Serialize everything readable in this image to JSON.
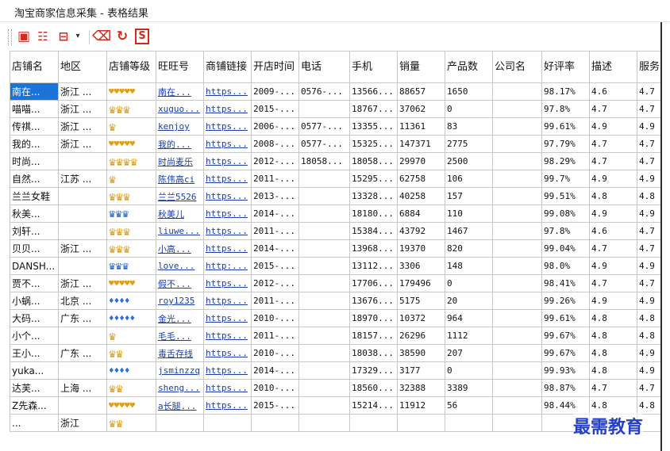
{
  "window": {
    "title": "淘宝商家信息采集 - 表格结果"
  },
  "toolbar": {
    "icons": [
      "excel-export-icon",
      "list-view-icon",
      "table-view-icon",
      "eraser-icon",
      "refresh-icon",
      "sql-export-icon"
    ],
    "colors": {
      "red": "#d42a1e"
    }
  },
  "table": {
    "columns": [
      "店铺名",
      "地区",
      "店铺等级",
      "旺旺号",
      "商铺链接",
      "开店时间",
      "电话",
      "手机",
      "销量",
      "产品数",
      "公司名",
      "好评率",
      "描述",
      "服务"
    ],
    "rows": [
      {
        "shop": "南在...",
        "region": "浙江 ...",
        "rank": "♥♥♥♥♥",
        "rank_kind": "heart",
        "ww": "南在...",
        "link": "https...",
        "open": "2009-...",
        "tel": "0576-...",
        "mobile": "13566...",
        "sales": "88657",
        "products": "1650",
        "company": "",
        "rate": "98.17%",
        "desc": "4.6",
        "serv": "4.7"
      },
      {
        "shop": "喵喵...",
        "region": "浙江 ...",
        "rank": "♛♛♛",
        "rank_kind": "crown",
        "ww": "xuguo...",
        "link": "https...",
        "open": "2015-...",
        "tel": "",
        "mobile": "18767...",
        "sales": "37062",
        "products": "0",
        "company": "",
        "rate": "97.8%",
        "desc": "4.7",
        "serv": "4.7"
      },
      {
        "shop": "传祺...",
        "region": "浙江 ...",
        "rank": "♛",
        "rank_kind": "crown",
        "ww": "kenjoy",
        "link": "https...",
        "open": "2006-...",
        "tel": "0577-...",
        "mobile": "13355...",
        "sales": "11361",
        "products": "83",
        "company": "",
        "rate": "99.61%",
        "desc": "4.9",
        "serv": "4.9"
      },
      {
        "shop": "我的...",
        "region": "浙江 ...",
        "rank": "♥♥♥♥♥",
        "rank_kind": "heart",
        "ww": "我的...",
        "link": "https...",
        "open": "2008-...",
        "tel": "0577-...",
        "mobile": "15325...",
        "sales": "147371",
        "products": "2775",
        "company": "",
        "rate": "97.79%",
        "desc": "4.7",
        "serv": "4.7"
      },
      {
        "shop": "时尚...",
        "region": "",
        "rank": "♛♛♛♛",
        "rank_kind": "crown",
        "ww": "时尚麦乐",
        "link": "https...",
        "open": "2012-...",
        "tel": "18058...",
        "mobile": "18058...",
        "sales": "29970",
        "products": "2500",
        "company": "",
        "rate": "98.29%",
        "desc": "4.7",
        "serv": "4.7"
      },
      {
        "shop": "自然...",
        "region": "江苏 ...",
        "rank": "♛",
        "rank_kind": "crown",
        "ww": "陈伟高ci",
        "link": "https...",
        "open": "2011-...",
        "tel": "",
        "mobile": "15295...",
        "sales": "62758",
        "products": "106",
        "company": "",
        "rate": "99.7%",
        "desc": "4.9",
        "serv": "4.9"
      },
      {
        "shop": "兰兰女鞋",
        "region": "",
        "rank": "♛♛♛",
        "rank_kind": "crown",
        "ww": "兰兰5526",
        "link": "https...",
        "open": "2013-...",
        "tel": "",
        "mobile": "13328...",
        "sales": "40258",
        "products": "157",
        "company": "",
        "rate": "99.51%",
        "desc": "4.8",
        "serv": "4.8"
      },
      {
        "shop": "秋美...",
        "region": "",
        "rank": "♛♛♛",
        "rank_kind": "bcrown",
        "ww": "秋美儿",
        "link": "https...",
        "open": "2014-...",
        "tel": "",
        "mobile": "18180...",
        "sales": "6884",
        "products": "110",
        "company": "",
        "rate": "99.08%",
        "desc": "4.9",
        "serv": "4.9"
      },
      {
        "shop": "刘轩...",
        "region": "",
        "rank": "♛♛♛",
        "rank_kind": "crown",
        "ww": "liuwe...",
        "link": "https...",
        "open": "2011-...",
        "tel": "",
        "mobile": "15384...",
        "sales": "43792",
        "products": "1467",
        "company": "",
        "rate": "97.8%",
        "desc": "4.6",
        "serv": "4.7"
      },
      {
        "shop": "贝贝...",
        "region": "浙江 ...",
        "rank": "♛♛♛",
        "rank_kind": "crown",
        "ww": "小高...",
        "link": "https...",
        "open": "2014-...",
        "tel": "",
        "mobile": "13968...",
        "sales": "19370",
        "products": "820",
        "company": "",
        "rate": "99.04%",
        "desc": "4.7",
        "serv": "4.7"
      },
      {
        "shop": "DANSH...",
        "region": "",
        "rank": "♛♛♛",
        "rank_kind": "bcrown",
        "ww": "love...",
        "link": "http:...",
        "open": "2015-...",
        "tel": "",
        "mobile": "13112...",
        "sales": "3306",
        "products": "148",
        "company": "",
        "rate": "98.0%",
        "desc": "4.9",
        "serv": "4.9"
      },
      {
        "shop": "贾不...",
        "region": "浙江 ...",
        "rank": "♥♥♥♥♥",
        "rank_kind": "heart",
        "ww": "假不...",
        "link": "https...",
        "open": "2012-...",
        "tel": "",
        "mobile": "17706...",
        "sales": "179496",
        "products": "0",
        "company": "",
        "rate": "98.41%",
        "desc": "4.7",
        "serv": "4.7"
      },
      {
        "shop": "小蜗...",
        "region": "北京 ...",
        "rank": "♦♦♦♦",
        "rank_kind": "diamond",
        "ww": "roy1235",
        "link": "https...",
        "open": "2011-...",
        "tel": "",
        "mobile": "13676...",
        "sales": "5175",
        "products": "20",
        "company": "",
        "rate": "99.26%",
        "desc": "4.9",
        "serv": "4.9"
      },
      {
        "shop": "大码...",
        "region": "广东 ...",
        "rank": "♦♦♦♦♦",
        "rank_kind": "diamond",
        "ww": "金光...",
        "link": "https...",
        "open": "2010-...",
        "tel": "",
        "mobile": "18970...",
        "sales": "10372",
        "products": "964",
        "company": "",
        "rate": "99.61%",
        "desc": "4.8",
        "serv": "4.8"
      },
      {
        "shop": "小个...",
        "region": "",
        "rank": "♛",
        "rank_kind": "crown",
        "ww": "毛毛...",
        "link": "https...",
        "open": "2011-...",
        "tel": "",
        "mobile": "18157...",
        "sales": "26296",
        "products": "1112",
        "company": "",
        "rate": "99.67%",
        "desc": "4.8",
        "serv": "4.8"
      },
      {
        "shop": "王小...",
        "region": "广东 ...",
        "rank": "♛♛",
        "rank_kind": "crown",
        "ww": "毒舌存线",
        "link": "https...",
        "open": "2010-...",
        "tel": "",
        "mobile": "18038...",
        "sales": "38590",
        "products": "207",
        "company": "",
        "rate": "99.67%",
        "desc": "4.8",
        "serv": "4.9"
      },
      {
        "shop": "yuka...",
        "region": "",
        "rank": "♦♦♦♦",
        "rank_kind": "diamond",
        "ww": "jsminzzq",
        "link": "https...",
        "open": "2014-...",
        "tel": "",
        "mobile": "17329...",
        "sales": "3177",
        "products": "0",
        "company": "",
        "rate": "99.93%",
        "desc": "4.8",
        "serv": "4.9"
      },
      {
        "shop": "达芙...",
        "region": "上海 ...",
        "rank": "♛♛",
        "rank_kind": "crown",
        "ww": "sheng...",
        "link": "https...",
        "open": "2010-...",
        "tel": "",
        "mobile": "18560...",
        "sales": "32388",
        "products": "3389",
        "company": "",
        "rate": "98.87%",
        "desc": "4.7",
        "serv": "4.7"
      },
      {
        "shop": "Z先森...",
        "region": "",
        "rank": "♥♥♥♥♥",
        "rank_kind": "heart",
        "ww": "a长腿...",
        "link": "https...",
        "open": "2015-...",
        "tel": "",
        "mobile": "15214...",
        "sales": "11912",
        "products": "56",
        "company": "",
        "rate": "98.44%",
        "desc": "4.8",
        "serv": "4.8"
      },
      {
        "shop": "...",
        "region": "浙江",
        "rank": "♛♛",
        "rank_kind": "crown",
        "ww": "",
        "link": "",
        "open": "",
        "tel": "",
        "mobile": "",
        "sales": "",
        "products": "",
        "company": "",
        "rate": "",
        "desc": "",
        "serv": ""
      }
    ]
  },
  "watermark": {
    "text": "最需教育"
  }
}
